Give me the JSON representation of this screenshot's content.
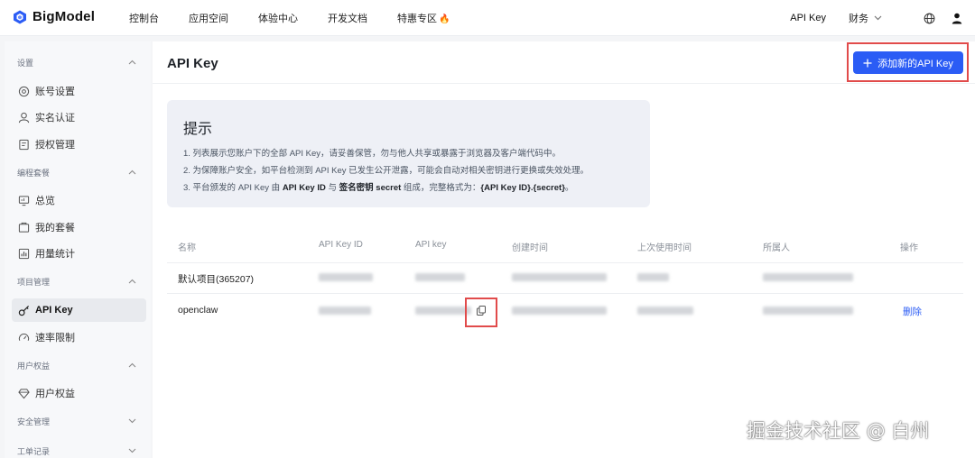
{
  "app": {
    "logo_text": "BigModel"
  },
  "nav": {
    "items": [
      "控制台",
      "应用空间",
      "体验中心",
      "开发文档"
    ],
    "special": "特惠专区",
    "special_icon": "🔥",
    "right_apikey": "API Key",
    "right_finance": "财务"
  },
  "sidebar": {
    "sections": [
      {
        "title": "设置",
        "items": [
          "账号设置",
          "实名认证",
          "授权管理"
        ]
      },
      {
        "title": "编程套餐",
        "items": [
          "总览",
          "我的套餐",
          "用量统计"
        ]
      },
      {
        "title": "项目管理",
        "items": [
          "API Key",
          "速率限制"
        ]
      },
      {
        "title": "用户权益",
        "items": [
          "用户权益"
        ]
      },
      {
        "title": "安全管理",
        "items": []
      },
      {
        "title": "工单记录",
        "items": []
      }
    ]
  },
  "main": {
    "title": "API Key",
    "add_button": "添加新的API Key",
    "tip": {
      "title": "提示",
      "line1": "1. 列表展示您账户下的全部 API Key，请妥善保管，勿与他人共享或暴露于浏览器及客户端代码中。",
      "line2": "2. 为保障账户安全，如平台检测到 API Key 已发生公开泄露，可能会自动对相关密钥进行更换或失效处理。",
      "line3_a": "3. 平台颁发的 API Key 由 ",
      "line3_b": "API Key ID",
      "line3_c": " 与 ",
      "line3_d": "签名密钥 secret",
      "line3_e": " 组成，完整格式为：",
      "line3_f": "{API Key ID}.{secret}",
      "line3_g": "。"
    },
    "table": {
      "columns": [
        "名称",
        "API Key ID",
        "API key",
        "创建时间",
        "上次使用时间",
        "所属人",
        "操作"
      ],
      "rows": [
        {
          "name": "默认项目(365207)",
          "action": ""
        },
        {
          "name": "openclaw",
          "action": "删除"
        }
      ]
    }
  },
  "watermark": "掘金技术社区 @ 白州",
  "colors": {
    "primary": "#2b5cf5",
    "highlight_box": "#e14b4b"
  }
}
